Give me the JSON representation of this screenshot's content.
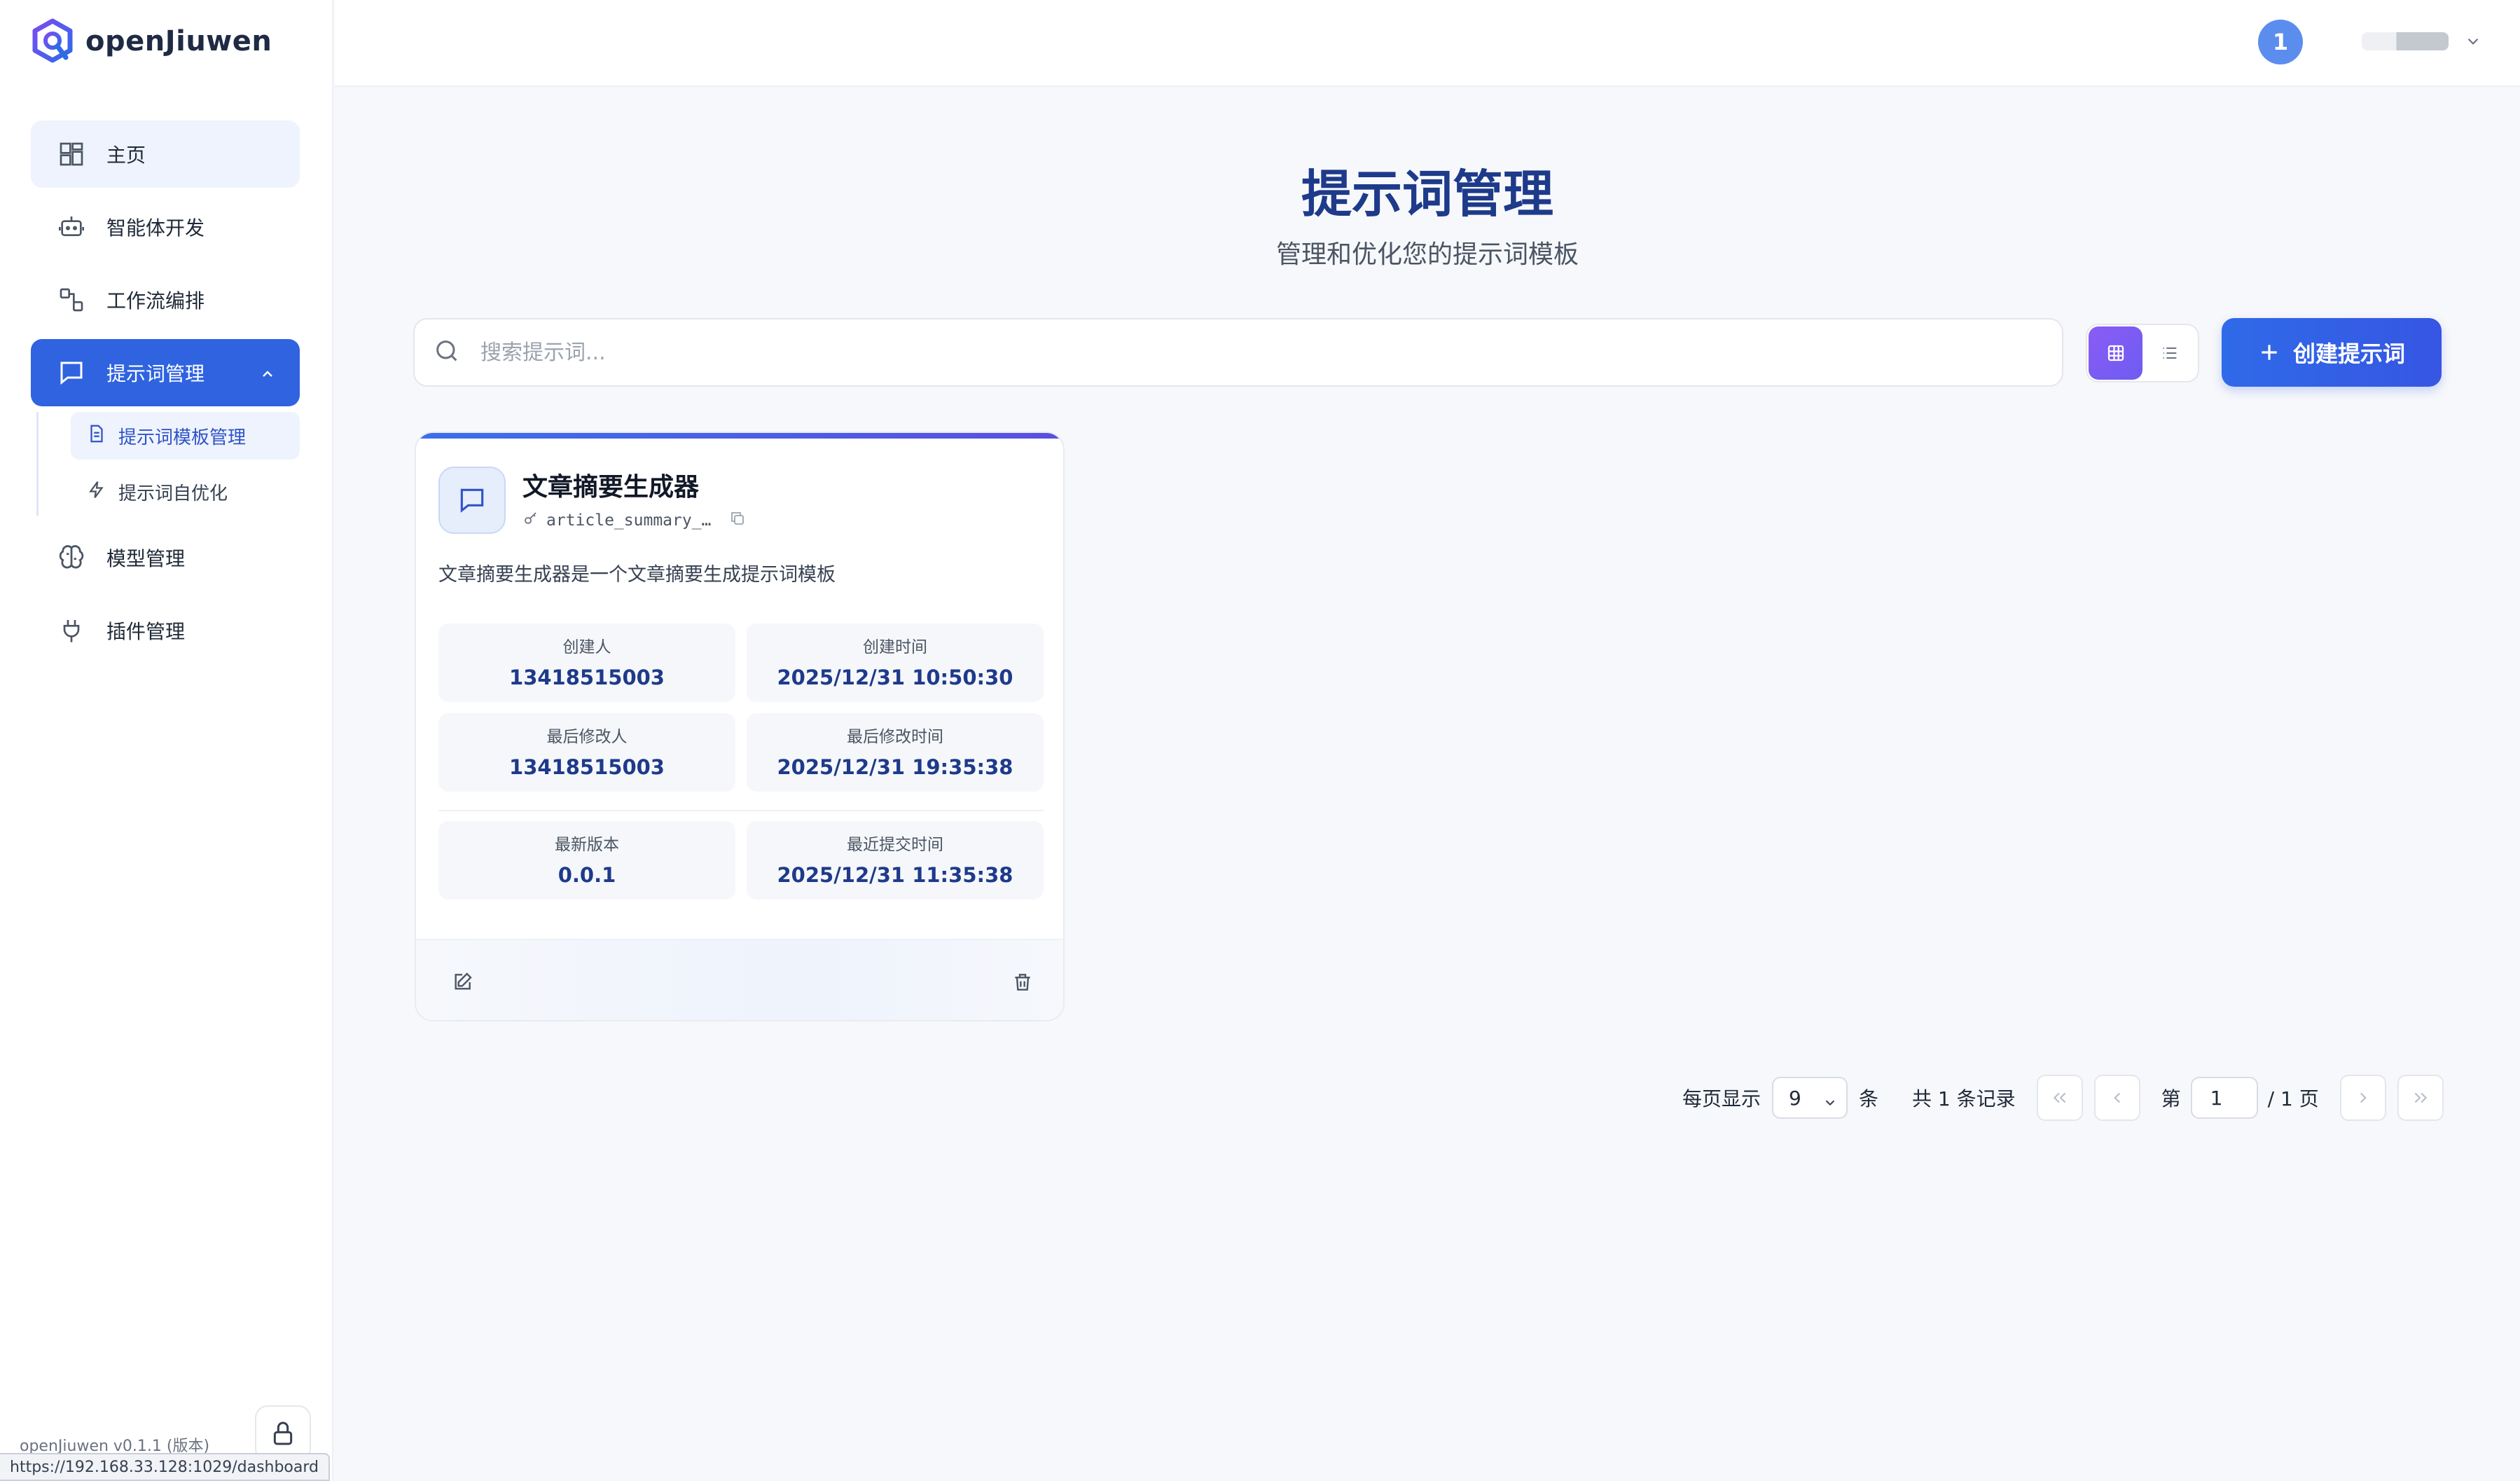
{
  "app": {
    "name": "openJiuwen",
    "version_text": "openJiuwen v0.1.1 (版本)",
    "status_url": "https://192.168.33.128:1029/dashboard"
  },
  "sidebar": {
    "items": [
      {
        "label": "主页",
        "icon": "dashboard-icon"
      },
      {
        "label": "智能体开发",
        "icon": "robot-icon"
      },
      {
        "label": "工作流编排",
        "icon": "workflow-icon"
      },
      {
        "label": "提示词管理",
        "icon": "message-icon"
      },
      {
        "label": "模型管理",
        "icon": "brain-icon"
      },
      {
        "label": "插件管理",
        "icon": "plug-icon"
      }
    ],
    "subitems": [
      {
        "label": "提示词模板管理",
        "icon": "document-icon"
      },
      {
        "label": "提示词自优化",
        "icon": "lightning-icon"
      }
    ]
  },
  "header": {
    "avatar_text": "1"
  },
  "page": {
    "title": "提示词管理",
    "subtitle": "管理和优化您的提示词模板"
  },
  "search": {
    "placeholder": "搜索提示词..."
  },
  "toolbar": {
    "create_label": "创建提示词",
    "view_mode": "grid"
  },
  "card": {
    "title": "文章摘要生成器",
    "key": "article_summary_…",
    "description": "文章摘要生成器是一个文章摘要生成提示词模板",
    "stats": [
      {
        "label": "创建人",
        "value": "13418515003"
      },
      {
        "label": "创建时间",
        "value": "2025/12/31 10:50:30"
      },
      {
        "label": "最后修改人",
        "value": "13418515003"
      },
      {
        "label": "最后修改时间",
        "value": "2025/12/31 19:35:38"
      },
      {
        "label": "最新版本",
        "value": "0.0.1"
      },
      {
        "label": "最近提交时间",
        "value": "2025/12/31 11:35:38"
      }
    ]
  },
  "pagination": {
    "per_page_label": "每页显示",
    "per_page_value": "9",
    "unit": "条",
    "total_text": "共 1 条记录",
    "page_prefix": "第",
    "page_value": "1",
    "page_suffix": "/ 1 页"
  },
  "colors": {
    "primary": "#2f63e0",
    "title": "#1e3a8a",
    "accent_purple": "#7c5cf2"
  }
}
